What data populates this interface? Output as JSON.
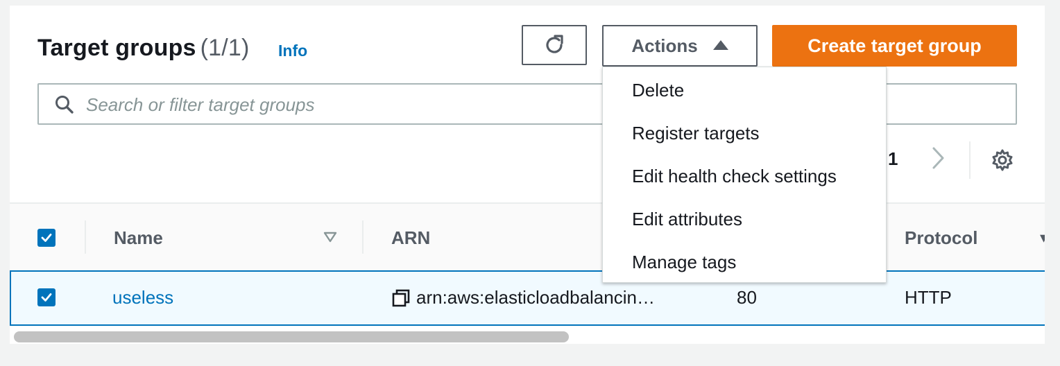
{
  "header": {
    "title": "Target groups",
    "count": "(1/1)",
    "info_link": "Info"
  },
  "toolbar": {
    "refresh_icon": "refresh-icon",
    "actions_label": "Actions",
    "create_label": "Create target group"
  },
  "search": {
    "placeholder": "Search or filter target groups",
    "value": ""
  },
  "pagination": {
    "current_page": "1"
  },
  "table": {
    "columns": [
      "Name",
      "ARN",
      "Protocol"
    ],
    "rows": [
      {
        "selected": true,
        "name": "useless",
        "arn": "arn:aws:elasticloadbalancin…",
        "port": "80",
        "protocol": "HTTP"
      }
    ]
  },
  "actions_menu": {
    "items": [
      "Delete",
      "Register targets",
      "Edit health check settings",
      "Edit attributes",
      "Manage tags"
    ]
  },
  "colors": {
    "primary": "#ec7211",
    "link": "#0073bb",
    "selected_row_bg": "#f1faff"
  }
}
